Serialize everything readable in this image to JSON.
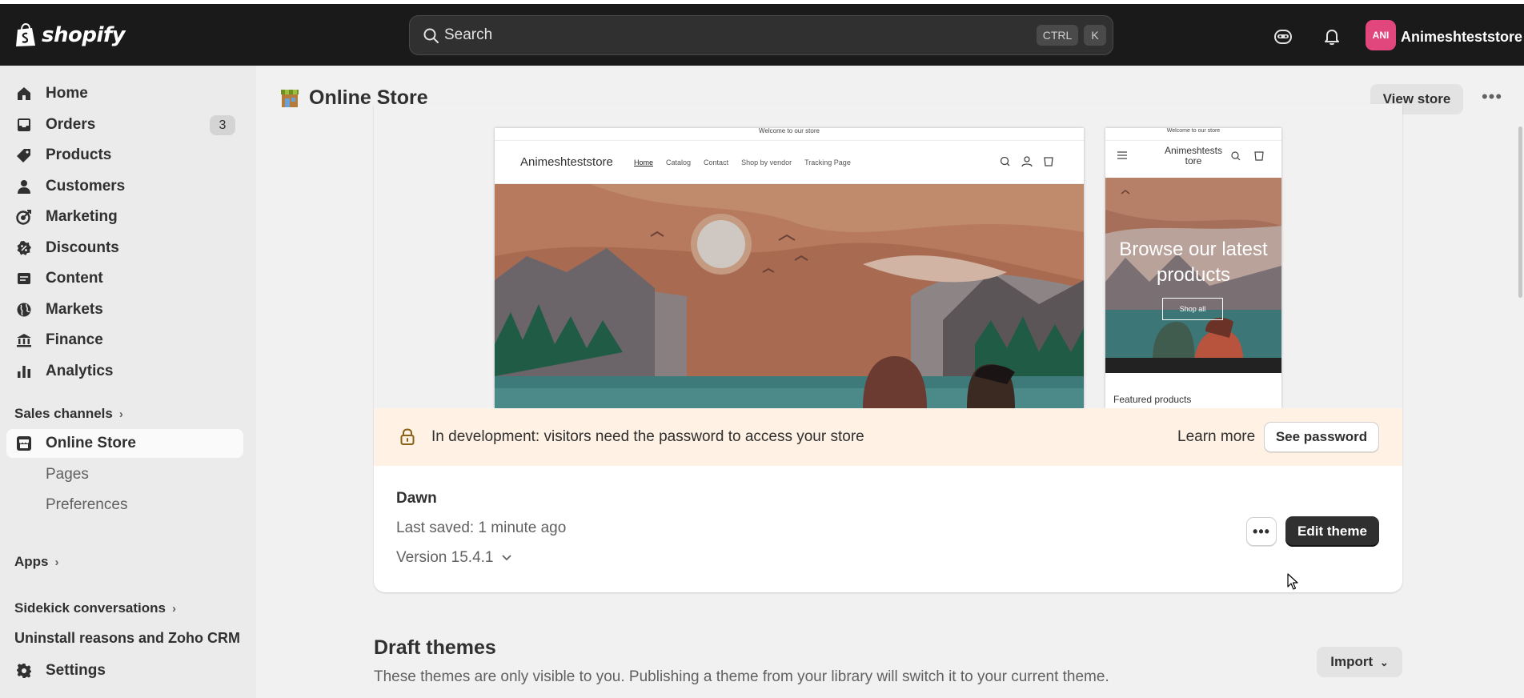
{
  "topbar": {
    "brand": "shopify",
    "search_placeholder": "Search",
    "shortcut_ctrl": "CTRL",
    "shortcut_k": "K",
    "avatar_initials": "ANI",
    "store_name": "Animeshteststore"
  },
  "sidebar": {
    "items": [
      {
        "label": "Home",
        "icon": "home-icon"
      },
      {
        "label": "Orders",
        "icon": "orders-icon",
        "badge": "3"
      },
      {
        "label": "Products",
        "icon": "tag-icon"
      },
      {
        "label": "Customers",
        "icon": "person-icon"
      },
      {
        "label": "Marketing",
        "icon": "target-icon"
      },
      {
        "label": "Discounts",
        "icon": "discount-icon"
      },
      {
        "label": "Content",
        "icon": "content-icon"
      },
      {
        "label": "Markets",
        "icon": "globe-icon"
      },
      {
        "label": "Finance",
        "icon": "bank-icon"
      },
      {
        "label": "Analytics",
        "icon": "bar-chart-icon"
      }
    ],
    "sales_channels_label": "Sales channels",
    "online_store_label": "Online Store",
    "sub_items": [
      "Pages",
      "Preferences"
    ],
    "apps_label": "Apps",
    "sidekick_label": "Sidekick conversations",
    "uninstall_label": "Uninstall reasons and Zoho CRM",
    "settings_label": "Settings"
  },
  "main": {
    "page_title": "Online Store",
    "view_store_label": "View store",
    "preview": {
      "announcement": "Welcome to our store",
      "brand": "Animeshteststore",
      "nav": [
        "Home",
        "Catalog",
        "Contact",
        "Shop by vendor",
        "Tracking Page"
      ],
      "mobile_brand": "Animeshtests tore",
      "hero_title": "Browse our latest products",
      "shop_all": "Shop all",
      "featured": "Featured products"
    },
    "banner": {
      "text": "In development: visitors need the password to access your store",
      "learn_more": "Learn more",
      "see_password": "See password"
    },
    "theme": {
      "name": "Dawn",
      "last_saved": "Last saved: 1 minute ago",
      "version": "Version 15.4.1",
      "edit_label": "Edit theme"
    },
    "drafts": {
      "title": "Draft themes",
      "description": "These themes are only visible to you. Publishing a theme from your library will switch it to your current theme.",
      "import_label": "Import"
    }
  },
  "colors": {
    "topbar_bg": "#1a1a1a",
    "avatar_bg": "#e1467c",
    "banner_bg": "#fff1e3",
    "primary_button": "#303030"
  }
}
